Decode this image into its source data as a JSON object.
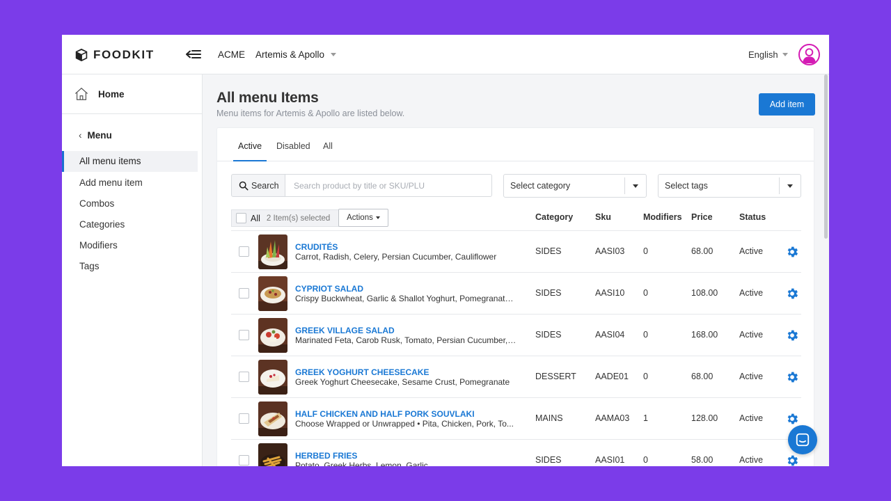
{
  "brand": {
    "name": "FOODKIT"
  },
  "header": {
    "organization": "ACME",
    "venue": "Artemis & Apollo",
    "language": "English"
  },
  "sidebar": {
    "home": "Home",
    "menu_back": "Menu",
    "items": [
      {
        "label": "All menu items",
        "active": true
      },
      {
        "label": "Add menu item",
        "active": false
      },
      {
        "label": "Combos",
        "active": false
      },
      {
        "label": "Categories",
        "active": false
      },
      {
        "label": "Modifiers",
        "active": false
      },
      {
        "label": "Tags",
        "active": false
      }
    ]
  },
  "page": {
    "title": "All menu Items",
    "subtitle": "Menu items for Artemis & Apollo are listed below.",
    "add_button": "Add item"
  },
  "tabs": [
    {
      "label": "Active",
      "active": true
    },
    {
      "label": "Disabled",
      "active": false
    },
    {
      "label": "All",
      "active": false
    }
  ],
  "filters": {
    "search_button": "Search",
    "search_placeholder": "Search product by title or SKU/PLU",
    "category_select": "Select category",
    "tags_select": "Select tags"
  },
  "bulk": {
    "all_label": "All",
    "selected_count": "2 Item(s) selected",
    "actions_button": "Actions"
  },
  "table": {
    "columns": [
      "Category",
      "Sku",
      "Modifiers",
      "Price",
      "Status"
    ],
    "rows": [
      {
        "name": "CRUDITÉS",
        "description": "Carrot, Radish, Celery, Persian Cucumber, Cauliflower",
        "category": "SIDES",
        "sku": "AASI03",
        "modifiers": "0",
        "price": "68.00",
        "status": "Active",
        "image": "crudites-photo"
      },
      {
        "name": "CYPRIOT SALAD",
        "description": "Crispy Buckwheat, Garlic & Shallot Yoghurt, Pomegranate,...",
        "category": "SIDES",
        "sku": "AASI10",
        "modifiers": "0",
        "price": "108.00",
        "status": "Active",
        "image": "cypriot-salad-photo"
      },
      {
        "name": "GREEK VILLAGE SALAD",
        "description": "Marinated Feta, Carob Rusk, Tomato, Persian Cucumber, R...",
        "category": "SIDES",
        "sku": "AASI04",
        "modifiers": "0",
        "price": "168.00",
        "status": "Active",
        "image": "greek-village-salad-photo"
      },
      {
        "name": "GREEK YOGHURT CHEESECAKE",
        "description": "Greek Yoghurt Cheesecake, Sesame Crust, Pomegranate",
        "category": "DESSERT",
        "sku": "AADE01",
        "modifiers": "0",
        "price": "68.00",
        "status": "Active",
        "image": "cheesecake-photo"
      },
      {
        "name": "HALF CHICKEN AND HALF PORK SOUVLAKI",
        "description": "Choose Wrapped or Unwrapped • Pita, Chicken, Pork, To...",
        "category": "MAINS",
        "sku": "AAMA03",
        "modifiers": "1",
        "price": "128.00",
        "status": "Active",
        "image": "souvlaki-photo"
      },
      {
        "name": "HERBED FRIES",
        "description": "Potato, Greek Herbs, Lemon, Garlic",
        "category": "SIDES",
        "sku": "AASI01",
        "modifiers": "0",
        "price": "58.00",
        "status": "Active",
        "image": "herbed-fries-photo"
      }
    ]
  },
  "colors": {
    "background": "#7b3ce9",
    "accent": "#1a78d4",
    "avatar_ring": "#d41bb4"
  },
  "icons": [
    "box-logo-icon",
    "collapse-menu-icon",
    "user-avatar-icon",
    "home-icon",
    "chevron-left-icon",
    "search-icon",
    "gear-icon",
    "chat-icon"
  ]
}
